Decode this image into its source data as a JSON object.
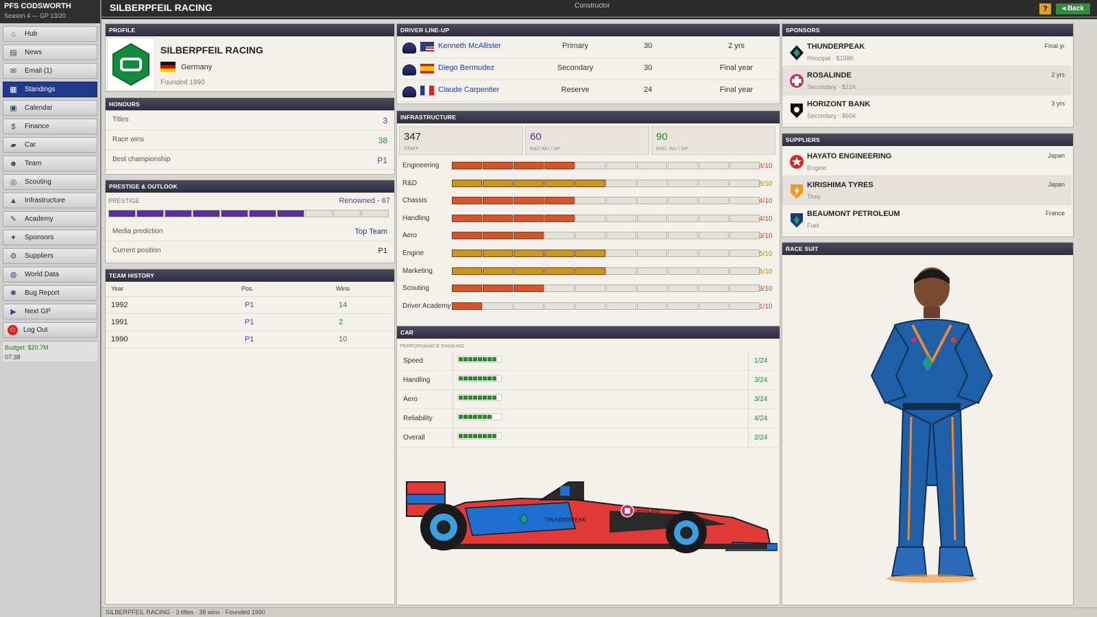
{
  "sidebar": {
    "app_title": "PFS CODSWORTH",
    "season": "Season 4 — GP 13/20",
    "items": [
      {
        "label": "Hub",
        "icon": "hub-icon"
      },
      {
        "label": "News",
        "icon": "news-icon"
      },
      {
        "label": "Email (1)",
        "icon": "email-icon"
      },
      {
        "label": "Standings",
        "icon": "standings-icon",
        "active": true
      },
      {
        "label": "Calendar",
        "icon": "calendar-icon"
      },
      {
        "label": "Finance",
        "icon": "finance-icon"
      },
      {
        "label": "Car",
        "icon": "car-icon"
      },
      {
        "label": "Team",
        "icon": "team-icon"
      },
      {
        "label": "Scouting",
        "icon": "scouting-icon"
      },
      {
        "label": "Infrastructure",
        "icon": "infrastructure-icon"
      },
      {
        "label": "Academy",
        "icon": "academy-icon"
      },
      {
        "label": "Sponsors",
        "icon": "sponsors-icon"
      },
      {
        "label": "Suppliers",
        "icon": "suppliers-icon"
      },
      {
        "label": "World Data",
        "icon": "world-data-icon"
      },
      {
        "label": "Bug Report",
        "icon": "bug-report-icon"
      },
      {
        "label": "Next GP",
        "icon": "next-gp-icon"
      },
      {
        "label": "Log Out",
        "icon": "power-icon"
      }
    ],
    "budget": "Budget: $20.7M",
    "time": "07:38"
  },
  "header": {
    "title": "SILBERPFEIL RACING",
    "mode": "Constructor",
    "help_label": "?",
    "back_label": "◂ Back"
  },
  "profile": {
    "section": "PROFILE",
    "team_name": "SILBERPFEIL RACING",
    "country": "Germany",
    "founded": "Founded 1990"
  },
  "honours": {
    "section": "HONOURS",
    "rows": [
      {
        "label": "Titles",
        "value": "3"
      },
      {
        "label": "Race wins",
        "value": "38"
      },
      {
        "label": "Best championship",
        "value": "P1"
      }
    ]
  },
  "prestige": {
    "section": "PRESTIGE & OUTLOOK",
    "label": "PRESTIGE",
    "value_text": "Renowned - 67",
    "value": 67,
    "segments_filled": 7,
    "segments_total": 10,
    "media_label": "Media prediction",
    "media_value": "Top Team",
    "position_label": "Current position",
    "position_value": "P1"
  },
  "history": {
    "section": "TEAM HISTORY",
    "columns": [
      "Year",
      "Pos.",
      "Wins"
    ],
    "rows": [
      [
        "1992",
        "P1",
        "14"
      ],
      [
        "1991",
        "P1",
        "2"
      ],
      [
        "1990",
        "P1",
        "10"
      ]
    ]
  },
  "drivers": {
    "section": "DRIVER LINE-UP",
    "rows": [
      {
        "name": "Kenneth McAllister",
        "role": "Primary",
        "age": "30",
        "contract": "2 yrs",
        "flag": "usa-flag-icon"
      },
      {
        "name": "Diego Bermudez",
        "role": "Secondary",
        "age": "30",
        "contract": "Final year",
        "flag": "spain-flag-icon"
      },
      {
        "name": "Claude Carpentier",
        "role": "Reserve",
        "age": "24",
        "contract": "Final year",
        "flag": "france-flag-icon"
      }
    ]
  },
  "infrastructure": {
    "section": "INFRASTRUCTURE",
    "stats": [
      {
        "value": "347",
        "label": "STAFF"
      },
      {
        "value": "60",
        "label": "R&D WU / GP"
      },
      {
        "value": "90",
        "label": "ENG. WU / GP"
      }
    ],
    "rows": [
      {
        "name": "Engineering",
        "level": 4,
        "text": "4/10"
      },
      {
        "name": "R&D",
        "level": 5,
        "text": "5/10"
      },
      {
        "name": "Chassis",
        "level": 4,
        "text": "4/10"
      },
      {
        "name": "Handling",
        "level": 4,
        "text": "4/10"
      },
      {
        "name": "Aero",
        "level": 3,
        "text": "3/10"
      },
      {
        "name": "Engine",
        "level": 5,
        "text": "5/10"
      },
      {
        "name": "Marketing",
        "level": 5,
        "text": "5/10"
      },
      {
        "name": "Scouting",
        "level": 3,
        "text": "3/10"
      },
      {
        "name": "Driver Academy",
        "level": 1,
        "text": "1/10"
      }
    ]
  },
  "car": {
    "section": "CAR",
    "subsection": "PERFORMANCE RANKING",
    "rows": [
      {
        "name": "Speed",
        "rank": "1/24",
        "pips": 8
      },
      {
        "name": "Handling",
        "rank": "3/24",
        "pips": 8
      },
      {
        "name": "Aero",
        "rank": "3/24",
        "pips": 8
      },
      {
        "name": "Reliability",
        "rank": "4/24",
        "pips": 7
      },
      {
        "name": "Overall",
        "rank": "2/24",
        "pips": 8
      }
    ],
    "livery_main_sponsor": "THUNDERPEAK",
    "livery_side_sponsor": "ROSALINDE"
  },
  "sponsors": {
    "section": "SPONSORS",
    "rows": [
      {
        "name": "THUNDERPEAK",
        "sub": "Principal · $158K",
        "term": "Final yr",
        "icon": "thunderpeak-logo-icon"
      },
      {
        "name": "ROSALINDE",
        "sub": "Secondary · $21K",
        "term": "2 yrs",
        "icon": "rosalinde-logo-icon"
      },
      {
        "name": "HORIZONT BANK",
        "sub": "Secondary · $66K",
        "term": "3 yrs",
        "icon": "horizont-bank-logo-icon"
      }
    ]
  },
  "suppliers": {
    "section": "SUPPLIERS",
    "rows": [
      {
        "name": "HAYATO ENGINEERING",
        "sub": "Engine",
        "country": "Japan",
        "icon": "hayato-logo-icon"
      },
      {
        "name": "KIRISHIMA TYRES",
        "sub": "Tires",
        "country": "Japan",
        "icon": "kirishima-logo-icon"
      },
      {
        "name": "BEAUMONT PETROLEUM",
        "sub": "Fuel",
        "country": "France",
        "icon": "beaumont-logo-icon"
      }
    ]
  },
  "race_suit": {
    "section": "RACE SUIT"
  },
  "status_bar": "SILBERPFEIL RACING · 3 titles · 38 wins · Founded 1990",
  "colors": {
    "accent_navy": "#1f3a8c",
    "orange_bar": "#d2552d",
    "gold_bar": "#c49a1a",
    "prestige_purple": "#5b2da0",
    "green": "#1e8a2a"
  }
}
